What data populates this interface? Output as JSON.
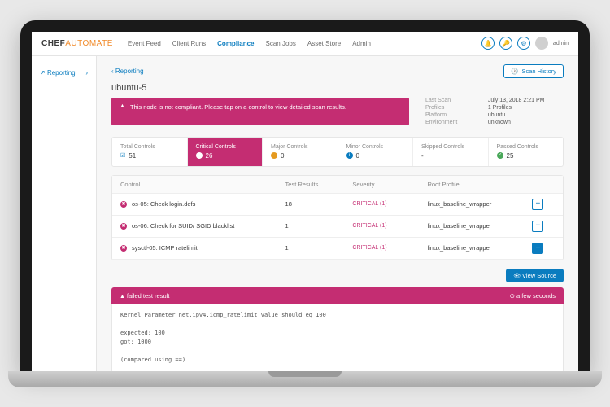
{
  "brand": {
    "a": "CHEF",
    "b": "AUTOMATE"
  },
  "nav": {
    "items": [
      {
        "label": "Event Feed"
      },
      {
        "label": "Client Runs"
      },
      {
        "label": "Compliance"
      },
      {
        "label": "Scan Jobs"
      },
      {
        "label": "Asset Store"
      },
      {
        "label": "Admin"
      }
    ],
    "active": 2
  },
  "user": {
    "label": "admin"
  },
  "sidebar": {
    "item": "Reporting"
  },
  "breadcrumb": "Reporting",
  "scan_history_btn": "Scan History",
  "node_title": "ubuntu-5",
  "alert_msg": "This node is not compliant. Please tap on a control to view detailed scan results.",
  "meta": {
    "last_scan_k": "Last Scan",
    "last_scan_v": "July 13, 2018 2:21 PM",
    "profiles_k": "Profiles",
    "profiles_v": "1 Profiles",
    "platform_k": "Platform",
    "platform_v": "ubuntu",
    "env_k": "Environment",
    "env_v": "unknown"
  },
  "stats": [
    {
      "label": "Total Controls",
      "icon": "grey",
      "value": "51"
    },
    {
      "label": "Critical Controls",
      "icon": "wh",
      "value": "26"
    },
    {
      "label": "Major Controls",
      "icon": "or",
      "value": "0"
    },
    {
      "label": "Minor Controls",
      "icon": "bl",
      "value": "0"
    },
    {
      "label": "Skipped Controls",
      "icon": "none",
      "value": "-"
    },
    {
      "label": "Passed Controls",
      "icon": "gr",
      "value": "25"
    }
  ],
  "table": {
    "headers": {
      "control": "Control",
      "test": "Test Results",
      "sev": "Severity",
      "root": "Root Profile"
    },
    "rows": [
      {
        "name": "os-05: Check login.defs",
        "tests": "18",
        "sev": "CRITICAL (1)",
        "root": "linux_baseline_wrapper",
        "expanded": false
      },
      {
        "name": "os-06: Check for SUID/ SGID blacklist",
        "tests": "1",
        "sev": "CRITICAL (1)",
        "root": "linux_baseline_wrapper",
        "expanded": false
      },
      {
        "name": "sysctl-05: ICMP ratelimit",
        "tests": "1",
        "sev": "CRITICAL (1)",
        "root": "linux_baseline_wrapper",
        "expanded": true
      }
    ]
  },
  "view_source_btn": "View Source",
  "fail": {
    "title": "failed test result",
    "age": "a few seconds",
    "line1": "Kernel Parameter net.ipv4.icmp_ratelimit value should eq 100",
    "body": "expected: 100\n     got: 1000\n\n(compared using ==)"
  }
}
